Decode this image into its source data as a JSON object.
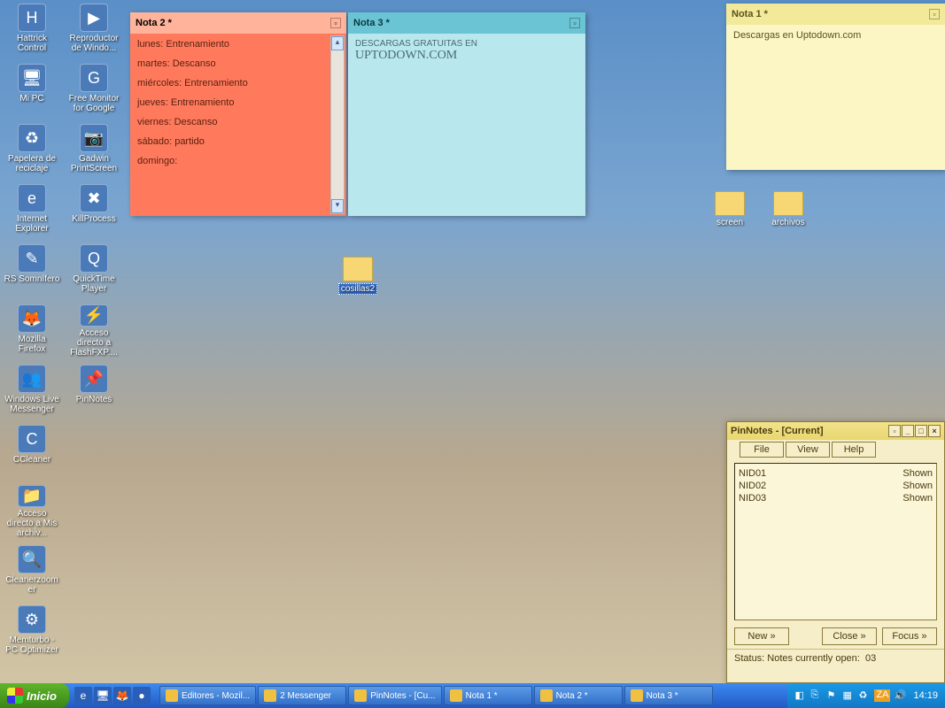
{
  "desktop_icons_col1": [
    {
      "label": "Hattrick Control"
    },
    {
      "label": "Mi PC"
    },
    {
      "label": "Papelera de reciclaje"
    },
    {
      "label": "Internet Explorer"
    },
    {
      "label": "RS Somnífero"
    },
    {
      "label": "Mozilla Firefox"
    },
    {
      "label": "Windows Live Messenger"
    },
    {
      "label": "CCleaner"
    },
    {
      "label": "Acceso directo a Mis archiv..."
    },
    {
      "label": "Cleanerzoomer"
    },
    {
      "label": "Memturbo - PC Optimizer"
    }
  ],
  "desktop_icons_col2": [
    {
      "label": "Reproductor de Windo..."
    },
    {
      "label": "Free Monitor for Google"
    },
    {
      "label": "Gadwin PrintScreen"
    },
    {
      "label": "KillProcess"
    },
    {
      "label": "QuickTime Player"
    },
    {
      "label": "Acceso directo a FlashFXP...."
    },
    {
      "label": "PinNotes"
    }
  ],
  "folders": {
    "cosillas2": "cosillas2",
    "screen": "screen",
    "archivos": "archivos"
  },
  "note1": {
    "title": "Nota 1 *",
    "body": "Descargas en Uptodown.com"
  },
  "note2": {
    "title": "Nota 2 *",
    "lines": [
      "lunes: Entrenamiento",
      "martes: Descanso",
      "miércoles: Entrenamiento",
      "jueves: Entrenamiento",
      "viernes: Descanso",
      "sábado: partido",
      "domingo:"
    ]
  },
  "note3": {
    "title": "Nota 3 *",
    "prefix": "DESCARGAS GRATUITAS EN ",
    "big": "UPTODOWN.COM"
  },
  "pinnotes": {
    "title": "PinNotes - [Current]",
    "menu": {
      "file": "File",
      "view": "View",
      "help": "Help"
    },
    "rows": [
      {
        "id": "NID01",
        "status": "Shown"
      },
      {
        "id": "NID02",
        "status": "Shown"
      },
      {
        "id": "NID03",
        "status": "Shown"
      }
    ],
    "buttons": {
      "new": "New »",
      "close": "Close »",
      "focus": "Focus »"
    },
    "status_label": "Status:  Notes currently open:",
    "status_count": "03"
  },
  "taskbar": {
    "start": "Inicio",
    "tasks": [
      "Editores - Mozil...",
      "2 Messenger",
      "PinNotes - [Cu...",
      "Nota 1 *",
      "Nota 2 *",
      "Nota 3 *"
    ],
    "clock": "14:19"
  }
}
